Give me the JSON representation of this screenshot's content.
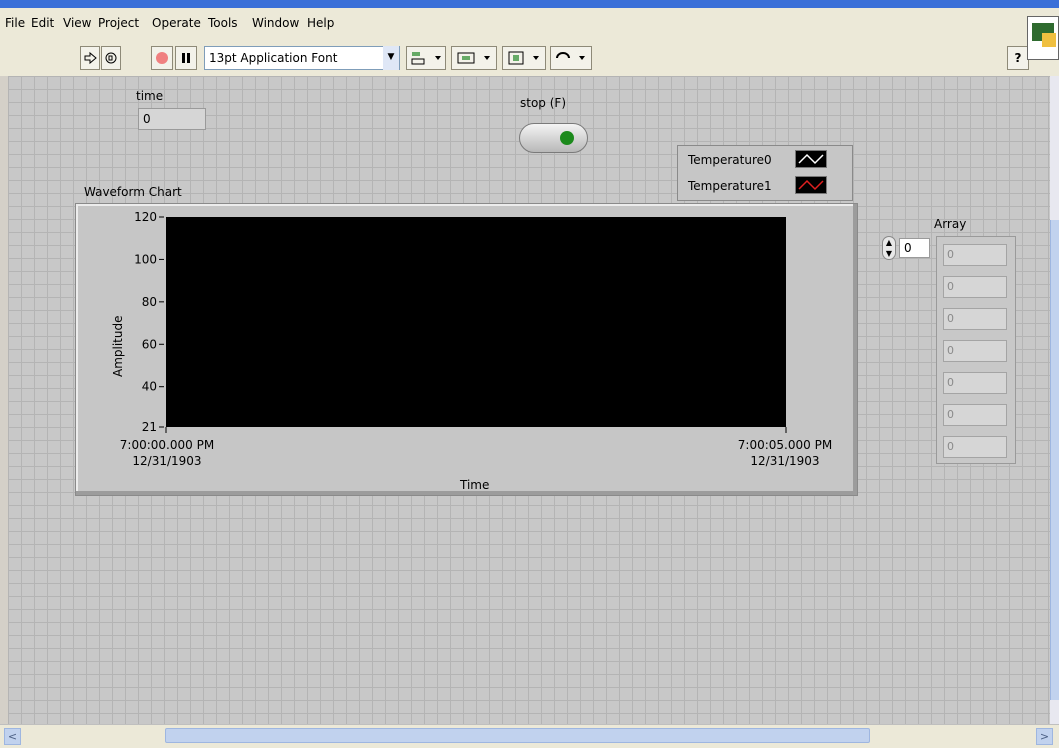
{
  "menu": [
    "File",
    "Edit",
    "View",
    "Project",
    "Operate",
    "Tools",
    "Window",
    "Help"
  ],
  "toolbar": {
    "font_name": "13pt Application Font",
    "help_glyph": "?"
  },
  "time_control": {
    "label": "time",
    "value": "0"
  },
  "stop_button": {
    "label": "stop (F)"
  },
  "legend": [
    {
      "name": "Temperature0",
      "color": "#ffffff"
    },
    {
      "name": "Temperature1",
      "color": "#e02020"
    }
  ],
  "chart_data": {
    "type": "line",
    "title": "Waveform Chart",
    "xlabel": "Time",
    "ylabel": "Amplitude",
    "ylim": [
      21,
      120
    ],
    "yticks": [
      "120",
      "100",
      "80",
      "60",
      "40",
      "21"
    ],
    "xticks": [
      {
        "time": "7:00:00.000 PM",
        "date": "12/31/1903"
      },
      {
        "time": "7:00:05.000 PM",
        "date": "12/31/1903"
      }
    ],
    "series": [
      {
        "name": "Temperature0",
        "values": []
      },
      {
        "name": "Temperature1",
        "values": []
      }
    ]
  },
  "array": {
    "label": "Array",
    "index": "0",
    "values": [
      "0",
      "0",
      "0",
      "0",
      "0",
      "0",
      "0"
    ]
  }
}
